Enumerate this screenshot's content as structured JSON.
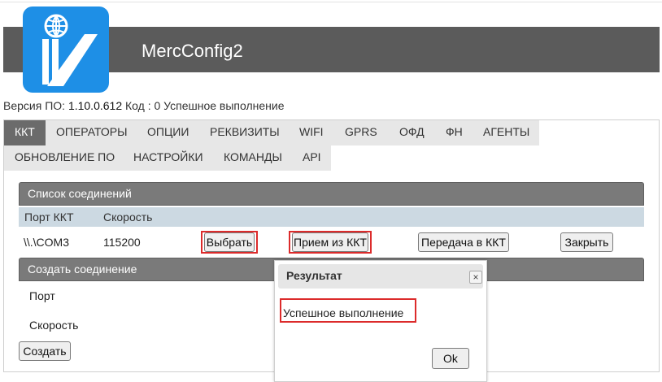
{
  "app": {
    "title": "MercConfig2"
  },
  "version": {
    "label": "Версия ПО:",
    "value": "1.10.0.612",
    "code_label": "Код :",
    "code_value": "0",
    "status": "Успешное выполнение"
  },
  "tabs": {
    "row1": [
      "ККТ",
      "ОПЕРАТОРЫ",
      "ОПЦИИ",
      "РЕКВИЗИТЫ",
      "WIFI",
      "GPRS",
      "ОФД",
      "ФН",
      "АГЕНТЫ"
    ],
    "row2": [
      "ОБНОВЛЕНИЕ ПО",
      "НАСТРОЙКИ",
      "КОМАНДЫ",
      "API"
    ],
    "active": "ККТ"
  },
  "connections": {
    "title": "Список соединений",
    "columns": [
      "Порт ККТ",
      "Скорость"
    ],
    "row": {
      "port": "\\\\.\\COM3",
      "speed": "115200"
    },
    "buttons": {
      "select": "Выбрать",
      "receive": "Прием из ККТ",
      "send": "Передача в ККТ",
      "close": "Закрыть"
    }
  },
  "create": {
    "title": "Создать соединение",
    "port_label": "Порт",
    "speed_label": "Скорость",
    "button": "Создать"
  },
  "dialog": {
    "title": "Результат",
    "close_glyph": "×",
    "message": "Успешное выполнение",
    "ok": "Ok"
  },
  "colors": {
    "titlebar": "#5b5b5b",
    "logo_bg": "#1e8fe6",
    "highlight": "#dc2b2b",
    "section_header": "#7a7a7a",
    "column_header": "#ccd9e2"
  }
}
